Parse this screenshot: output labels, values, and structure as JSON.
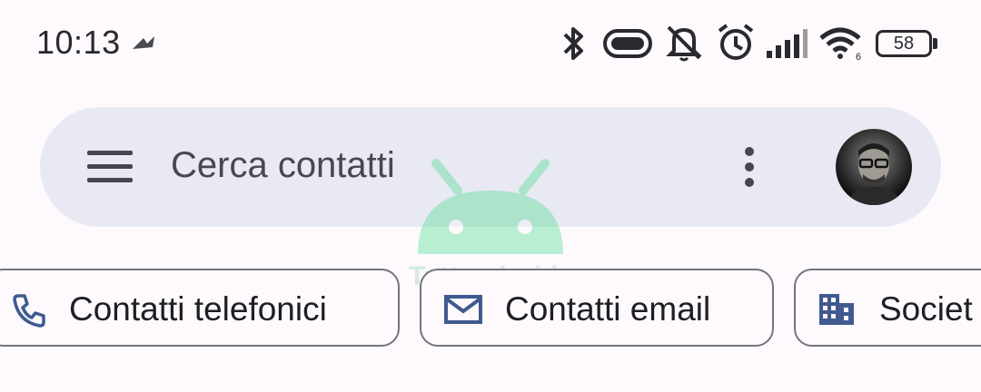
{
  "status_bar": {
    "time": "10:13",
    "battery": "58",
    "icons": [
      "bluetooth-icon",
      "vpn-pill-icon",
      "silent-bell-icon",
      "alarm-icon",
      "signal-icon",
      "wifi-icon",
      "battery-icon"
    ]
  },
  "search": {
    "placeholder": "Cerca contatti"
  },
  "chips": [
    {
      "label": "Contatti telefonici",
      "icon": "phone-icon"
    },
    {
      "label": "Contatti email",
      "icon": "mail-icon"
    },
    {
      "label": "Societ",
      "icon": "building-icon"
    }
  ],
  "watermark": {
    "text": "Tuttandroid"
  },
  "colors": {
    "background": "#fdf9fd",
    "search_bg": "#e8e9f3",
    "icon_blue": "#3f5a8f",
    "watermark_green": "#3ddc84"
  }
}
